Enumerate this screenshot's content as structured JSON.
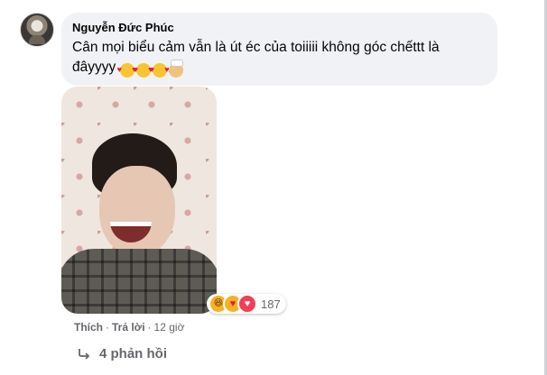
{
  "comment": {
    "author": "Nguyễn Đức Phúc",
    "text": "Cân mọi biểu cảm vẫn là út éc của toiiiii không góc chếttt là đâyyyy",
    "emojis": [
      "smiling-face-with-hearts",
      "smiling-face-with-hearts",
      "smiling-face-with-hearts",
      "cook"
    ],
    "reactions": {
      "icons": [
        "haha",
        "care",
        "love"
      ],
      "count": "187"
    },
    "actions": {
      "like": "Thích",
      "separator": "·",
      "reply": "Trả lời",
      "time": "12 giờ"
    },
    "replies": "4 phản hồi"
  },
  "colors": {
    "bubble_bg": "#f0f2f5",
    "secondary_text": "#65676b",
    "love": "#f33e58",
    "haha": "#f7b125"
  }
}
